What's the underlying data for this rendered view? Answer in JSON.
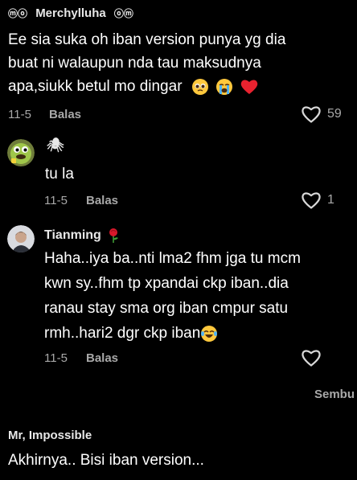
{
  "comments": [
    {
      "username_prefix": "ⓜⓞ",
      "username": "Merchylluha",
      "username_suffix": "ⓞⓜ",
      "lines": [
        "Ee sia suka oh iban version punya yg dia",
        "buat ni walaupun nda tau maksudnya",
        "apa,siukk betul mo dingar"
      ],
      "date": "11-5",
      "reply_label": "Balas",
      "likes": "59"
    },
    {
      "username": "🕷",
      "text": "tu la",
      "date": "11-5",
      "reply_label": "Balas",
      "likes": "1"
    },
    {
      "username": "Tianming",
      "lines": [
        "Haha..iya ba..nti lma2 fhm jga tu mcm",
        "kwn sy..fhm tp xpandai ckp iban..dia",
        "ranau stay sma org iban cmpur satu",
        "rmh..hari2 dgr ckp iban"
      ],
      "date": "11-5",
      "reply_label": "Balas"
    },
    {
      "username": "Mr, Impossible",
      "text": "Akhirnya.. Bisi iban version..."
    }
  ],
  "hide_label": "Sembu",
  "icons": [
    "heart-outline-icon",
    "pleading-face-emoji",
    "crying-face-emoji",
    "red-heart-emoji",
    "rose-emoji",
    "joy-face-emoji",
    "spider-icon"
  ]
}
